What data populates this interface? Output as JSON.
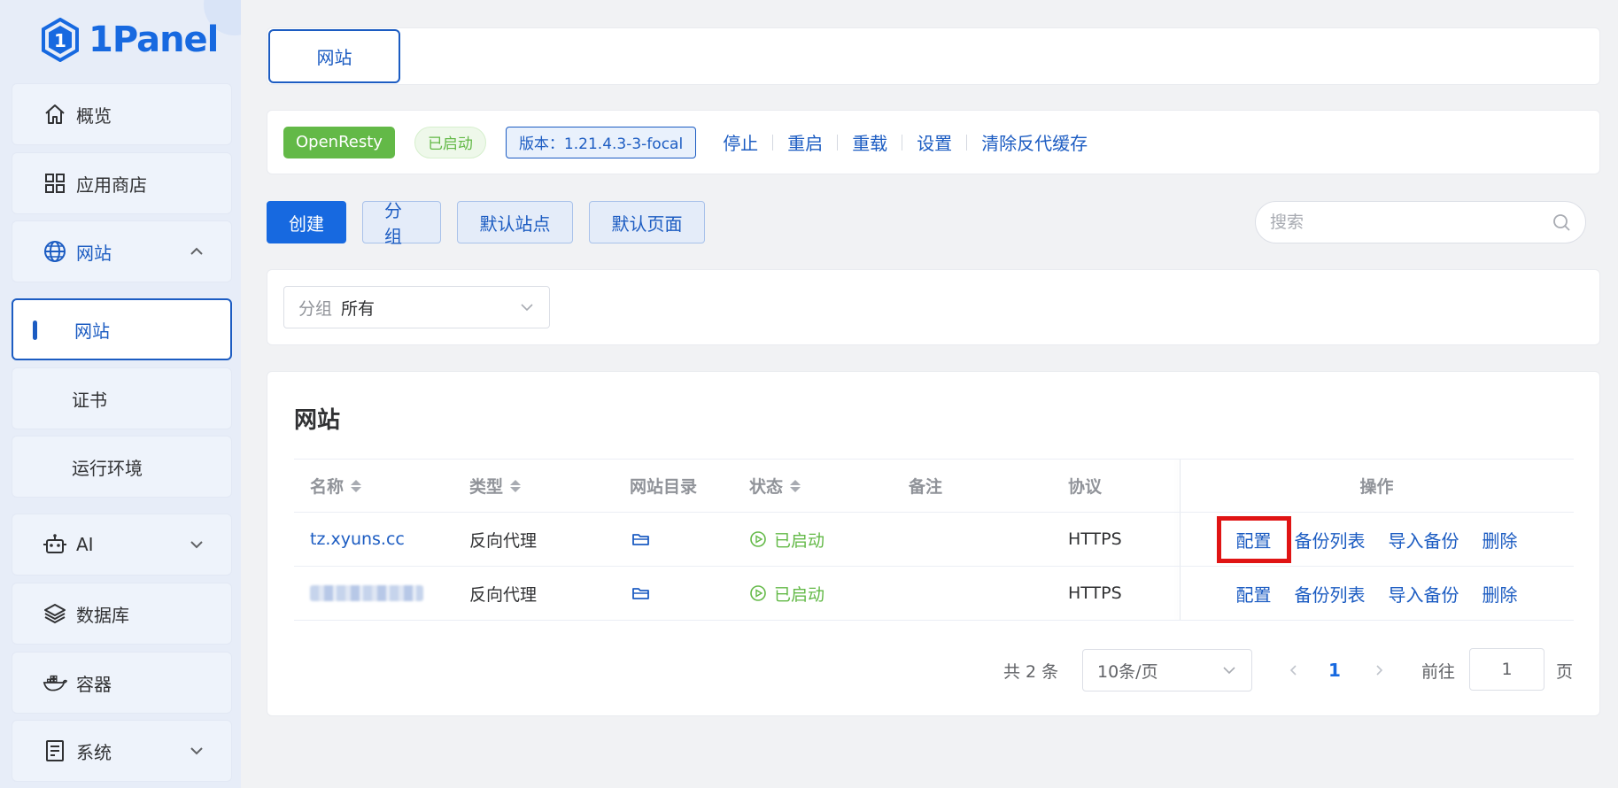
{
  "app": {
    "brand": "1Panel"
  },
  "sidebar": {
    "items": [
      {
        "label": "概览",
        "icon": "home-icon"
      },
      {
        "label": "应用商店",
        "icon": "grid-icon"
      },
      {
        "label": "网站",
        "icon": "globe-icon",
        "expanded": true
      },
      {
        "label": "网站",
        "sub": true,
        "active": true
      },
      {
        "label": "证书",
        "sub": true
      },
      {
        "label": "运行环境",
        "sub": true
      },
      {
        "label": "AI",
        "icon": "robot-icon",
        "expanded": false
      },
      {
        "label": "数据库",
        "icon": "layers-icon"
      },
      {
        "label": "容器",
        "icon": "docker-icon"
      },
      {
        "label": "系统",
        "icon": "server-icon",
        "expanded": false
      }
    ]
  },
  "tabs": {
    "active": "网站"
  },
  "status_bar": {
    "app_name": "OpenResty",
    "state": "已启动",
    "version": "版本：1.21.4.3-3-focal",
    "actions": [
      "停止",
      "重启",
      "重载",
      "设置",
      "清除反代缓存"
    ]
  },
  "toolbar": {
    "create": "创建",
    "group": "分组",
    "default_site": "默认站点",
    "default_page": "默认页面",
    "search_placeholder": "搜索"
  },
  "filter": {
    "prefix": "分组",
    "value": "所有"
  },
  "table": {
    "title": "网站",
    "columns": {
      "name": "名称",
      "type": "类型",
      "dir": "网站目录",
      "status": "状态",
      "note": "备注",
      "protocol": "协议",
      "ops": "操作"
    },
    "rows": [
      {
        "name": "tz.xyuns.cc",
        "type": "反向代理",
        "status": "已启动",
        "note": "",
        "protocol": "HTTPS",
        "ops": [
          "配置",
          "备份列表",
          "导入备份",
          "删除"
        ]
      },
      {
        "name": "",
        "name_blurred": true,
        "type": "反向代理",
        "status": "已启动",
        "note": "",
        "protocol": "HTTPS",
        "ops": [
          "配置",
          "备份列表",
          "导入备份",
          "删除"
        ]
      }
    ]
  },
  "pagination": {
    "total": "共 2 条",
    "page_size": "10条/页",
    "current_page": "1",
    "goto_label": "前往",
    "goto_value": "1",
    "goto_unit": "页"
  },
  "colors": {
    "primary": "#1769e0",
    "success": "#63b947",
    "highlight": "#e01414"
  }
}
